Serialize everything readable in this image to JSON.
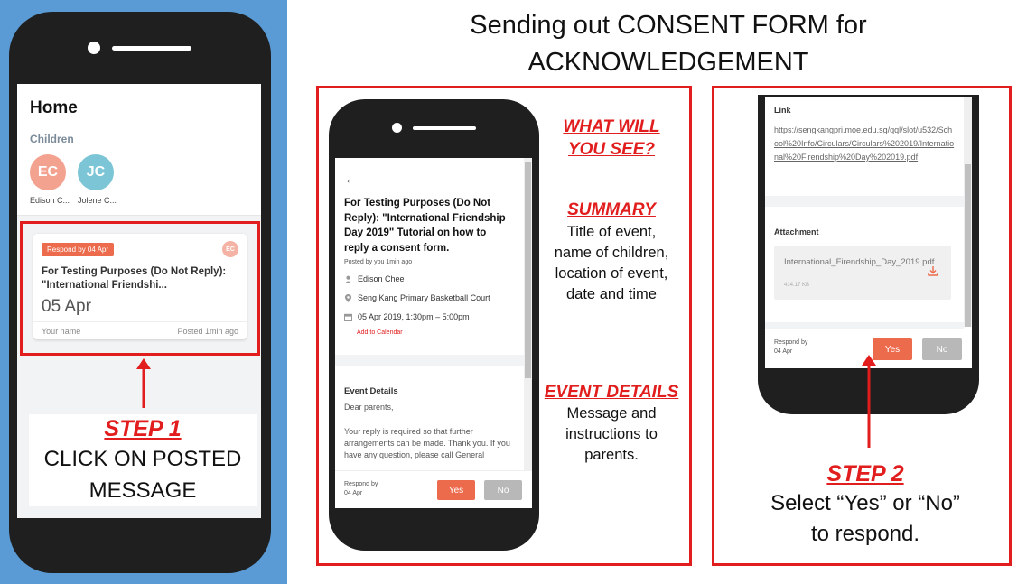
{
  "title": {
    "line1": "Sending out CONSENT FORM for",
    "line2": "ACKNOWLEDGEMENT"
  },
  "home_screen": {
    "title": "Home",
    "children_label": "Children",
    "children": [
      {
        "initials": "EC",
        "name": "Edison C...",
        "color": "#f4a290"
      },
      {
        "initials": "JC",
        "name": "Jolene C...",
        "color": "#7cc5d6"
      }
    ],
    "message_card": {
      "badge": "Respond by 04 Apr",
      "avatar_initials": "EC",
      "title": "For Testing Purposes (Do Not Reply): \"International Friendshi...",
      "date": "05 Apr",
      "footer_left": "Your name",
      "footer_right": "Posted 1min ago"
    }
  },
  "step1": {
    "heading": "STEP 1",
    "line1": "CLICK ON POSTED",
    "line2": "MESSAGE"
  },
  "detail_screen": {
    "back_arrow": "←",
    "title": "For Testing Purposes (Do Not Reply): \"International Friendship Day 2019\" Tutorial on how to reply a consent form.",
    "posted_by": "Posted by you 1min ago",
    "child_name": "Edison Chee",
    "location": "Seng Kang Primary Basketball Court",
    "datetime": "05 Apr 2019, 1:30pm – 5:00pm",
    "add_calendar": "Add to Calendar",
    "details_label": "Event Details",
    "details_greeting": "Dear parents,",
    "details_body": "Your reply is required so that further arrangements can be made. Thank you. If you have any question, please call General",
    "respond_by_line1": "Respond by",
    "respond_by_line2": "04 Apr",
    "yes_label": "Yes",
    "no_label": "No"
  },
  "annotations": {
    "what_heading_line1": "WHAT WILL",
    "what_heading_line2": "YOU SEE?",
    "summary_heading": "SUMMARY",
    "summary_lines": [
      "Title of event,",
      "name of children,",
      "location of event,",
      "date and time"
    ],
    "event_details_heading": "EVENT DETAILS",
    "event_details_lines": [
      "Message and",
      "instructions to",
      "parents."
    ]
  },
  "response_screen": {
    "link_label": "Link",
    "link_url": "https://sengkangpri.moe.edu.sg/qql/slot/u532/School%20Info/Circulars/Circulars%202019/International%20Firendship%20Day%202019.pdf",
    "attachment_label": "Attachment",
    "attachment_name": "International_Firendship_Day_2019.pdf",
    "attachment_size": "414.17 KB",
    "respond_by_line1": "Respond by",
    "respond_by_line2": "04 Apr",
    "yes_label": "Yes",
    "no_label": "No"
  },
  "step2": {
    "heading": "STEP 2",
    "line1": "Select “Yes” or “No”",
    "line2": "to respond."
  },
  "colors": {
    "panel_blue": "#5b9bd5",
    "annotation_red": "#e11d1d",
    "accent_orange": "#ec6b4c"
  }
}
